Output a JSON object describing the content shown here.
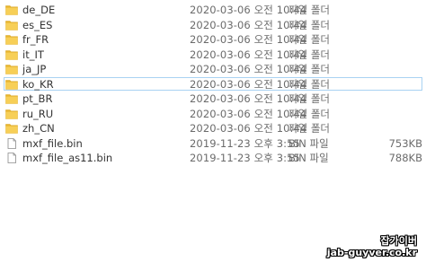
{
  "files": [
    {
      "name": "de_DE",
      "date": "2020-03-06 오전 10:44",
      "type": "파일 폴더",
      "size": "",
      "icon": "folder-icon"
    },
    {
      "name": "es_ES",
      "date": "2020-03-06 오전 10:44",
      "type": "파일 폴더",
      "size": "",
      "icon": "folder-icon"
    },
    {
      "name": "fr_FR",
      "date": "2020-03-06 오전 10:44",
      "type": "파일 폴더",
      "size": "",
      "icon": "folder-icon"
    },
    {
      "name": "it_IT",
      "date": "2020-03-06 오전 10:44",
      "type": "파일 폴더",
      "size": "",
      "icon": "folder-icon"
    },
    {
      "name": "ja_JP",
      "date": "2020-03-06 오전 10:44",
      "type": "파일 폴더",
      "size": "",
      "icon": "folder-icon"
    },
    {
      "name": "ko_KR",
      "date": "2020-03-06 오전 10:44",
      "type": "파일 폴더",
      "size": "",
      "icon": "folder-icon",
      "selected": true
    },
    {
      "name": "pt_BR",
      "date": "2020-03-06 오전 10:44",
      "type": "파일 폴더",
      "size": "",
      "icon": "folder-icon"
    },
    {
      "name": "ru_RU",
      "date": "2020-03-06 오전 10:44",
      "type": "파일 폴더",
      "size": "",
      "icon": "folder-icon"
    },
    {
      "name": "zh_CN",
      "date": "2020-03-06 오전 10:44",
      "type": "파일 폴더",
      "size": "",
      "icon": "folder-icon"
    },
    {
      "name": "mxf_file.bin",
      "date": "2019-11-23 오후 3:55",
      "type": "BIN 파일",
      "size": "753KB",
      "icon": "file-icon"
    },
    {
      "name": "mxf_file_as11.bin",
      "date": "2019-11-23 오후 3:55",
      "type": "BIN 파일",
      "size": "788KB",
      "icon": "file-icon"
    }
  ],
  "watermark": {
    "line1": "잡가이버",
    "line2": "jab-guyver.co.kr"
  },
  "colors": {
    "folder": "#f5c542",
    "selection_border": "#a9d2f2"
  }
}
